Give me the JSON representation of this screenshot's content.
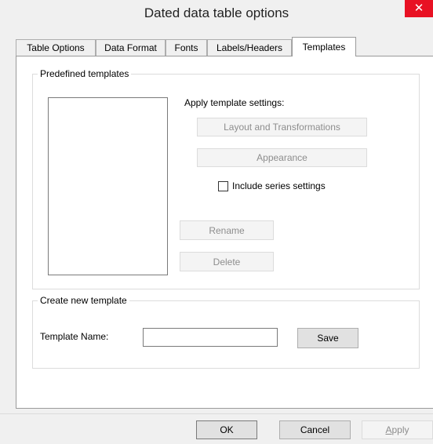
{
  "window": {
    "title": "Dated data table options",
    "close_glyph": "✕"
  },
  "tabs": [
    {
      "label": "Table Options",
      "active": false
    },
    {
      "label": "Data Format",
      "active": false
    },
    {
      "label": "Fonts",
      "active": false
    },
    {
      "label": "Labels/Headers",
      "active": false
    },
    {
      "label": "Templates",
      "active": true
    }
  ],
  "predefined": {
    "legend": "Predefined templates",
    "apply_label": "Apply template settings:",
    "layout_button": "Layout and Transformations",
    "appearance_button": "Appearance",
    "include_series_label": "Include series settings",
    "include_series_checked": false,
    "rename_button": "Rename",
    "delete_button": "Delete",
    "templates": []
  },
  "create": {
    "legend": "Create new template",
    "name_label": "Template Name:",
    "name_value": "",
    "save_button": "Save"
  },
  "footer": {
    "ok_button": "OK",
    "cancel_button": "Cancel",
    "apply_button": "Apply"
  }
}
